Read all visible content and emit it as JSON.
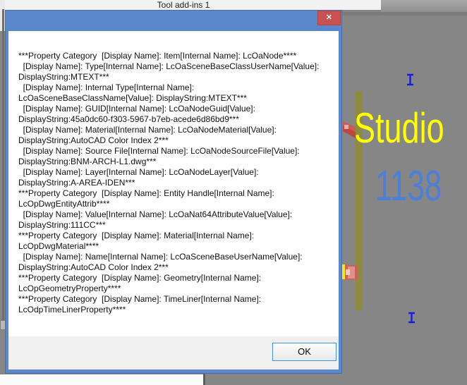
{
  "ribbon": {
    "tab_label": "Tool add-ins 1"
  },
  "dialog": {
    "close_glyph": "✕",
    "ok_label": "OK",
    "message": "***Property Category  [Display Name]: Item[Internal Name]: LcOaNode****\n  [Display Name]: Type[Internal Name]: LcOaSceneBaseClassUserName[Value]:\nDisplayString:MTEXT***\n  [Display Name]: Internal Type[Internal Name]:\nLcOaSceneBaseClassName[Value]: DisplayString:MTEXT***\n  [Display Name]: GUID[Internal Name]: LcOaNodeGuid[Value]:\nDisplayString:45a0dc60-f303-5967-b7eb-acede6d86bd9***\n  [Display Name]: Material[Internal Name]: LcOaNodeMaterial[Value]:\nDisplayString:AutoCAD Color Index 2***\n  [Display Name]: Source File[Internal Name]: LcOaNodeSourceFile[Value]:\nDisplayString:BNM-ARCH-L1.dwg***\n  [Display Name]: Layer[Internal Name]: LcOaNodeLayer[Value]:\nDisplayString:A-AREA-IDEN***\n***Property Category  [Display Name]: Entity Handle[Internal Name]:\nLcOpDwgEntityAttrib****\n  [Display Name]: Value[Internal Name]: LcOaNat64AttributeValue[Value]:\nDisplayString:111CC***\n***Property Category  [Display Name]: Material[Internal Name]:\nLcOpDwgMaterial****\n  [Display Name]: Name[Internal Name]: LcOaSceneBaseUserName[Value]:\nDisplayString:AutoCAD Color Index 2***\n***Property Category  [Display Name]: Geometry[Internal Name]:\nLcOpGeometryProperty****\n***Property Category  [Display Name]: TimeLiner[Internal Name]:\nLcOdpTimeLinerProperty****"
  },
  "viewport": {
    "studio_label": "Studio",
    "room_number": "1138"
  },
  "colors": {
    "titlebar_blue": "#5b87cd",
    "close_red": "#c85252",
    "canvas_gray": "#868686",
    "studio_yellow": "#ffff00",
    "number_blue": "#4d7ed8",
    "cursor_blue": "#1b1be0",
    "bar_olive": "#8c8c3c",
    "flag_red": "#c0453f",
    "ok_focus_border": "#3e94de"
  }
}
